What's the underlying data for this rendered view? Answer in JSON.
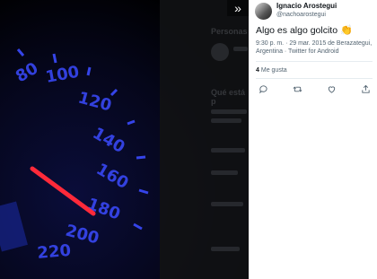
{
  "viewer": {
    "expand_icon": "chevrons-right-icon",
    "background_timeline": {
      "heading_1": "Personas",
      "heading_2": "Qué está p"
    }
  },
  "tweet": {
    "author_name": "Ignacio Arostegui",
    "author_handle": "@nachoarostegui",
    "text": "Algo es algo golcito",
    "emoji": "👏",
    "timestamp": "9:30 p. m. · 29 mar. 2015 de Berazategui, Argentina · Twitter for Android",
    "likes_count": "4",
    "likes_label": "Me gusta",
    "actions": [
      "reply-icon",
      "retweet-icon",
      "like-icon",
      "share-icon"
    ]
  },
  "colors": {
    "dial_blue": "#2a3cff",
    "needle_red": "#ff2a3a",
    "panel_bg": "#ffffff",
    "text_secondary": "#536471"
  }
}
